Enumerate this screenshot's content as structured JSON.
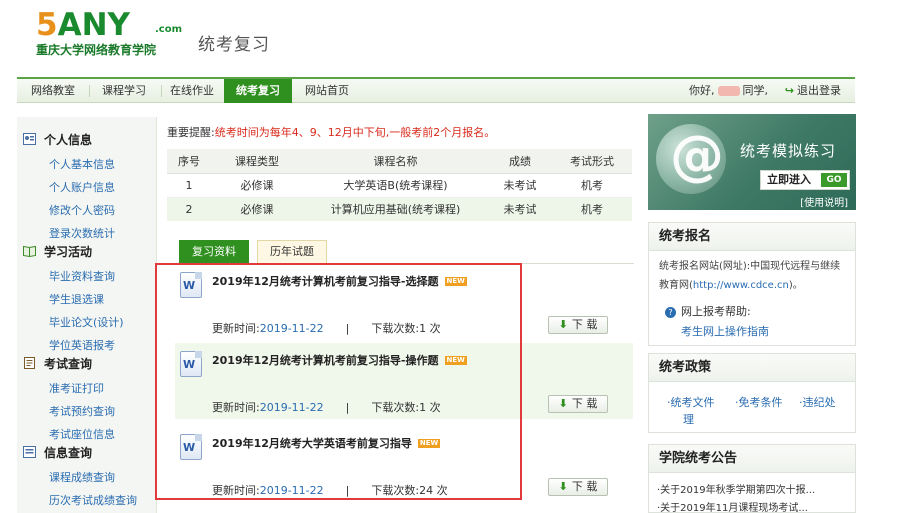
{
  "header": {
    "logo_text": "5ANY",
    "logo_com": ".com",
    "logo_subtitle": "重庆大学网络教育学院",
    "page_title": "统考复习"
  },
  "topnav": {
    "items": [
      "网络教室",
      "课程学习",
      "在线作业",
      "统考复习",
      "网站首页"
    ],
    "active_index": 3,
    "greeting_prefix": "你好,",
    "greeting_suffix": "同学,",
    "logout": "退出登录"
  },
  "sidebar": {
    "sections": [
      {
        "title": "个人信息",
        "icon": "person-card-icon",
        "items": [
          "个人基本信息",
          "个人账户信息",
          "修改个人密码",
          "登录次数统计"
        ]
      },
      {
        "title": "学习活动",
        "icon": "book-icon",
        "items": [
          "毕业资料查询",
          "学生退选课",
          "毕业论文(设计)",
          "学位英语报考"
        ]
      },
      {
        "title": "考试查询",
        "icon": "exam-icon",
        "items": [
          "准考证打印",
          "考试预约查询",
          "考试座位信息"
        ]
      },
      {
        "title": "信息查询",
        "icon": "info-icon",
        "items": [
          "课程成绩查询",
          "历次考试成绩查询"
        ]
      }
    ]
  },
  "notice": {
    "label": "重要提醒:",
    "text": "统考时间为每年4、9、12月中下旬,一般考前2个月报名。"
  },
  "course_table": {
    "headers": [
      "序号",
      "课程类型",
      "课程名称",
      "成绩",
      "考试形式"
    ],
    "rows": [
      [
        "1",
        "必修课",
        "大学英语B(统考课程)",
        "未考试",
        "机考"
      ],
      [
        "2",
        "必修课",
        "计算机应用基础(统考课程)",
        "未考试",
        "机考"
      ]
    ]
  },
  "tabs": [
    "复习资料",
    "历年试题"
  ],
  "documents": [
    {
      "title": "2019年12月统考计算机考前复习指导-选择题",
      "badge": "NEW",
      "updated_label": "更新时间:",
      "updated": "2019-11-22",
      "downloads_label": "下载次数:",
      "downloads": "1",
      "unit": "次",
      "download_btn": "下 载"
    },
    {
      "title": "2019年12月统考计算机考前复习指导-操作题",
      "badge": "NEW",
      "updated_label": "更新时间:",
      "updated": "2019-11-22",
      "downloads_label": "下载次数:",
      "downloads": "1",
      "unit": "次",
      "download_btn": "下 载"
    },
    {
      "title": "2019年12月统考大学英语考前复习指导",
      "badge": "NEW",
      "updated_label": "更新时间:",
      "updated": "2019-11-22",
      "downloads_label": "下载次数:",
      "downloads": "24",
      "unit": "次",
      "download_btn": "下 载"
    }
  ],
  "right": {
    "banner": {
      "title": "统考模拟练习",
      "enter": "立即进入",
      "go": "GO",
      "help": "[使用说明]"
    },
    "registration": {
      "title": "统考报名",
      "text": "统考报名网站(网址):中国现代远程与继续教育网(",
      "url": "http://www.cdce.cn",
      "text_end": ")。",
      "question": "网上报考帮助:",
      "guide_link": "考生网上操作指南"
    },
    "policy": {
      "title": "统考政策",
      "links": [
        "·统考文件",
        "·免考条件",
        "·违纪处",
        "理"
      ]
    },
    "announcements": {
      "title": "学院统考公告",
      "items": [
        "·关于2019年秋季学期第四次十报...",
        "·关于2019年11月课程现场考试..."
      ]
    }
  },
  "colors": {
    "brand_green": "#2f8f1f",
    "alert_red": "#d92a1c",
    "link_blue": "#2a6cb0",
    "highlight_border": "#e03a3a"
  }
}
